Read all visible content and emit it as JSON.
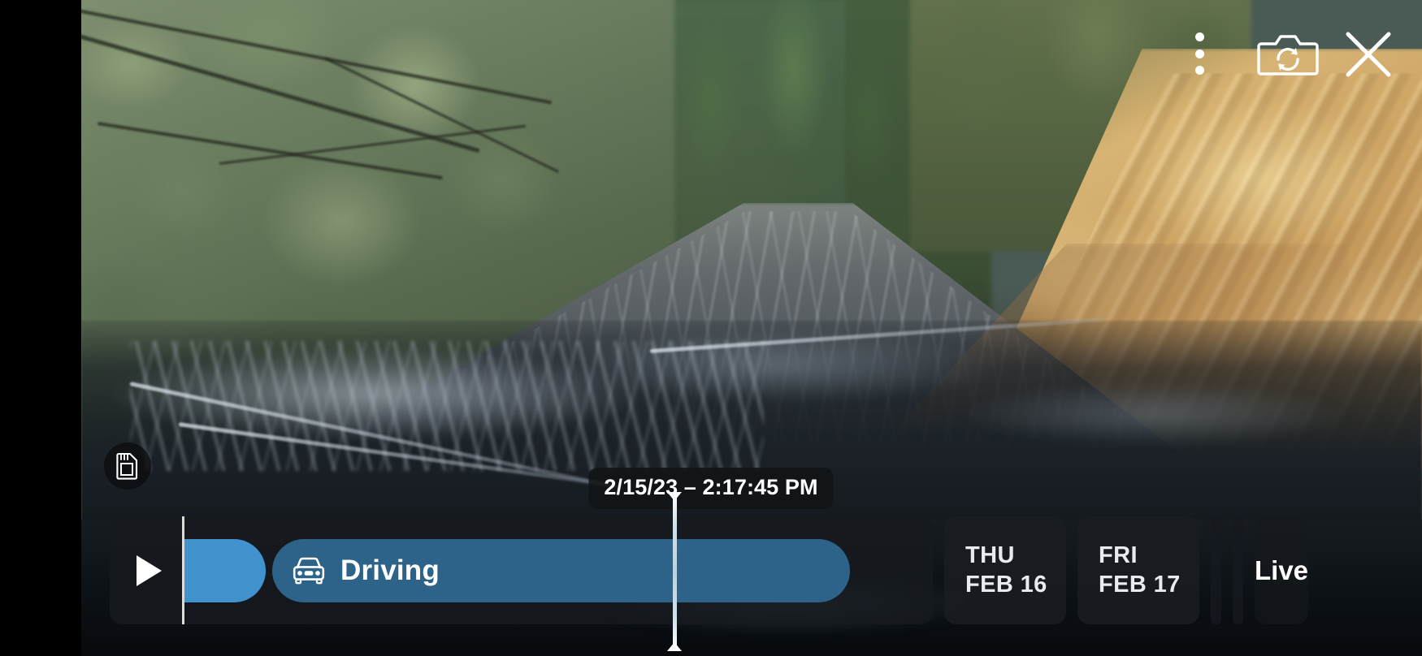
{
  "app": {
    "view_name": "dashcam-viewer",
    "timestamp_label": "2/15/23 – 2:17:45 PM"
  },
  "top_controls": {
    "menu": {
      "icon": "three-dots-vertical-icon",
      "label": "More options"
    },
    "camera_switch": {
      "icon": "camera-switch-icon",
      "label": "Switch camera"
    },
    "close": {
      "icon": "close-x-icon",
      "label": "Close"
    }
  },
  "storage": {
    "icon": "sd-card-icon",
    "label": "SD card"
  },
  "timeline": {
    "play_button": {
      "icon": "play-icon",
      "label": "Play"
    },
    "segments": [
      {
        "id": "seg-solid",
        "type": "clip",
        "label": "",
        "color": "#4193ce"
      },
      {
        "id": "seg-driving",
        "type": "event",
        "label": "Driving",
        "icon": "car-front-icon",
        "color": "#2d6389"
      }
    ],
    "playhead": {
      "label": "Playhead"
    },
    "day_cards": [
      {
        "dow": "THU",
        "dom": "FEB 16"
      },
      {
        "dow": "FRI",
        "dom": "FEB 17"
      }
    ],
    "ticks": [
      {
        "label": ""
      },
      {
        "label": ""
      }
    ],
    "live": {
      "label": "Live"
    }
  },
  "colors": {
    "accent_solid": "#4193ce",
    "accent_event": "#2d6389",
    "track": "#161a1f",
    "text": "#ffffff"
  }
}
